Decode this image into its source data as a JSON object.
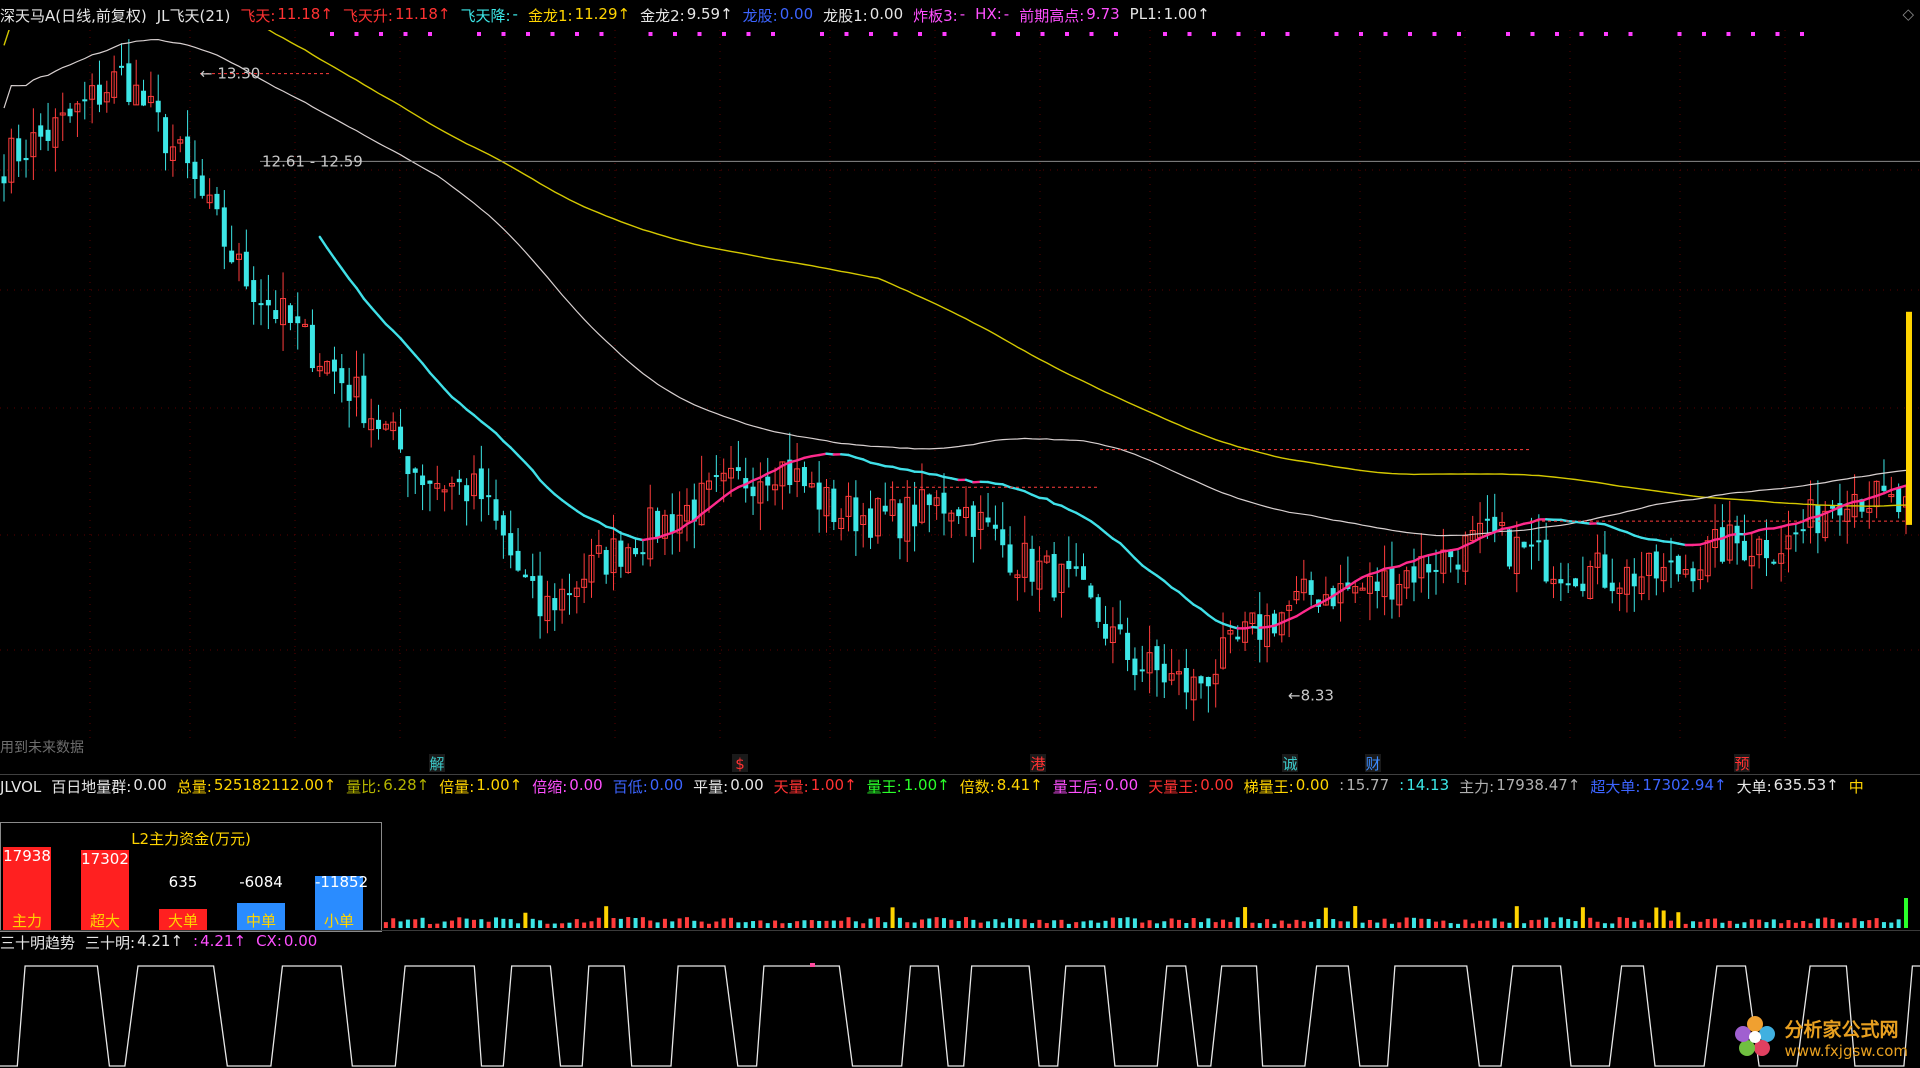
{
  "header": {
    "symbol": "深天马A(日线,前复权)",
    "indicator": "JL飞天(21)",
    "items": [
      {
        "label": "飞天:",
        "value": "11.18↑",
        "color": "red"
      },
      {
        "label": "飞天升:",
        "value": "11.18↑",
        "color": "red"
      },
      {
        "label": "飞天降:",
        "value": "-",
        "color": "cyan"
      },
      {
        "label": "金龙1:",
        "value": "11.29↑",
        "color": "yel"
      },
      {
        "label": "金龙2:",
        "value": "9.59↑",
        "color": "white"
      },
      {
        "label": "龙股:",
        "value": "0.00",
        "color": "blue"
      },
      {
        "label": "龙股1:",
        "value": "0.00",
        "color": "white"
      },
      {
        "label": "炸板3:",
        "value": "-",
        "color": "mag"
      },
      {
        "label": "HX:",
        "value": "-",
        "color": "mag"
      },
      {
        "label": "前期高点:",
        "value": "9.73",
        "color": "mag"
      },
      {
        "label": "PL1:",
        "value": "1.00↑",
        "color": "white"
      }
    ],
    "arrow_right": "◇"
  },
  "main_annotations": {
    "high_label": "13.30",
    "range_label": "12.61 - 12.59",
    "low_label": "8.33",
    "future_note": "用到未来数据",
    "signals": [
      {
        "text": "解",
        "color": "#3cc8c8"
      },
      {
        "text": "$",
        "color": "#ff3232"
      },
      {
        "text": "港",
        "color": "#ff3232"
      },
      {
        "text": "诚",
        "color": "#3cc8c8"
      },
      {
        "text": "财",
        "color": "#3c8cff"
      },
      {
        "text": "预",
        "color": "#ff3232"
      }
    ]
  },
  "vol_header": {
    "name": "JLVOL",
    "items": [
      {
        "label": "百日地量群:",
        "value": "0.00",
        "color": "white"
      },
      {
        "label": "总量:",
        "value": "525182112.00↑",
        "color": "yel"
      },
      {
        "label": "量比:",
        "value": "6.28↑",
        "color": "olive"
      },
      {
        "label": "倍量:",
        "value": "1.00↑",
        "color": "yel"
      },
      {
        "label": "倍缩:",
        "value": "0.00",
        "color": "mag"
      },
      {
        "label": "百低:",
        "value": "0.00",
        "color": "blue"
      },
      {
        "label": "平量:",
        "value": "0.00",
        "color": "white"
      },
      {
        "label": "天量:",
        "value": "1.00↑",
        "color": "red"
      },
      {
        "label": "量王:",
        "value": "1.00↑",
        "color": "grn"
      },
      {
        "label": "倍数:",
        "value": "8.41↑",
        "color": "yel"
      },
      {
        "label": "量王后:",
        "value": "0.00",
        "color": "mag"
      },
      {
        "label": "天量王:",
        "value": "0.00",
        "color": "red"
      },
      {
        "label": "梯量王:",
        "value": "0.00",
        "color": "yel"
      },
      {
        "label": ":",
        "value": "15.77",
        "color": "gray"
      },
      {
        "label": ":",
        "value": "14.13",
        "color": "cyan"
      },
      {
        "label": "主力:",
        "value": "17938.47↑",
        "color": "gray"
      },
      {
        "label": "超大单:",
        "value": "17302.94↑",
        "color": "blue"
      },
      {
        "label": "大单:",
        "value": "635.53↑",
        "color": "white"
      },
      {
        "label": "中",
        "value": "",
        "color": "yel"
      }
    ]
  },
  "l2_panel": {
    "title": "L2主力资金(万元)",
    "bars": [
      {
        "label": "主力",
        "value": "17938",
        "amount": 17938,
        "color": "#ff2020",
        "label_color": "#ffd400"
      },
      {
        "label": "超大",
        "value": "17302",
        "amount": 17302,
        "color": "#ff2020",
        "label_color": "#ffd400"
      },
      {
        "label": "大单",
        "value": "635",
        "amount": 635,
        "color": "#ff2020",
        "label_color": "#ffd400"
      },
      {
        "label": "中单",
        "value": "-6084",
        "amount": -6084,
        "color": "#2a8cff",
        "label_color": "#ffd400"
      },
      {
        "label": "小单",
        "value": "-11852",
        "amount": -11852,
        "color": "#2a8cff",
        "label_color": "#ffd400"
      }
    ]
  },
  "osc_header": {
    "name": "三十明趋势",
    "items": [
      {
        "label": "三十明:",
        "value": "4.21↑",
        "color": "white"
      },
      {
        "label": ":",
        "value": "4.21↑",
        "color": "mag"
      },
      {
        "label": "CX:",
        "value": "0.00",
        "color": "mag"
      }
    ]
  },
  "watermark": {
    "name": "分析家公式网",
    "url": "www.fxjgsw.com"
  },
  "colors": {
    "up": "#ff3c3c",
    "down": "#3ce6e6",
    "ma_long": "#d4c800",
    "ma_mid": "#d8d0d0",
    "feitian_up": "#ff2a8c",
    "feitian_down": "#40e0e8",
    "dash": "#ff3c3c"
  },
  "chart_data": {
    "type": "candlestick",
    "title": "深天马A(日线,前复权)",
    "price_range": [
      8.0,
      13.6
    ],
    "annotated_prices": {
      "high": 13.3,
      "low": 8.33,
      "range": [
        12.61,
        12.59
      ]
    },
    "series": [
      {
        "name": "飞天",
        "last": 11.18
      },
      {
        "name": "金龙1",
        "last": 11.29
      },
      {
        "name": "金龙2",
        "last": 9.59
      },
      {
        "name": "前期高点",
        "last": 9.73
      }
    ],
    "close_path": [
      12.6,
      12.9,
      13.3,
      12.6,
      11.7,
      11.2,
      10.7,
      10.1,
      9.95,
      9.0,
      9.4,
      9.7,
      9.95,
      10.2,
      9.8,
      9.75,
      9.9,
      9.45,
      9.2,
      8.6,
      8.4,
      8.85,
      9.15,
      9.2,
      9.4,
      9.6,
      9.4,
      9.3,
      9.3,
      9.55,
      9.55,
      10.0,
      9.8
    ],
    "oscillator": {
      "name": "三十明",
      "value": 4.21,
      "range": [
        0,
        5
      ]
    }
  }
}
